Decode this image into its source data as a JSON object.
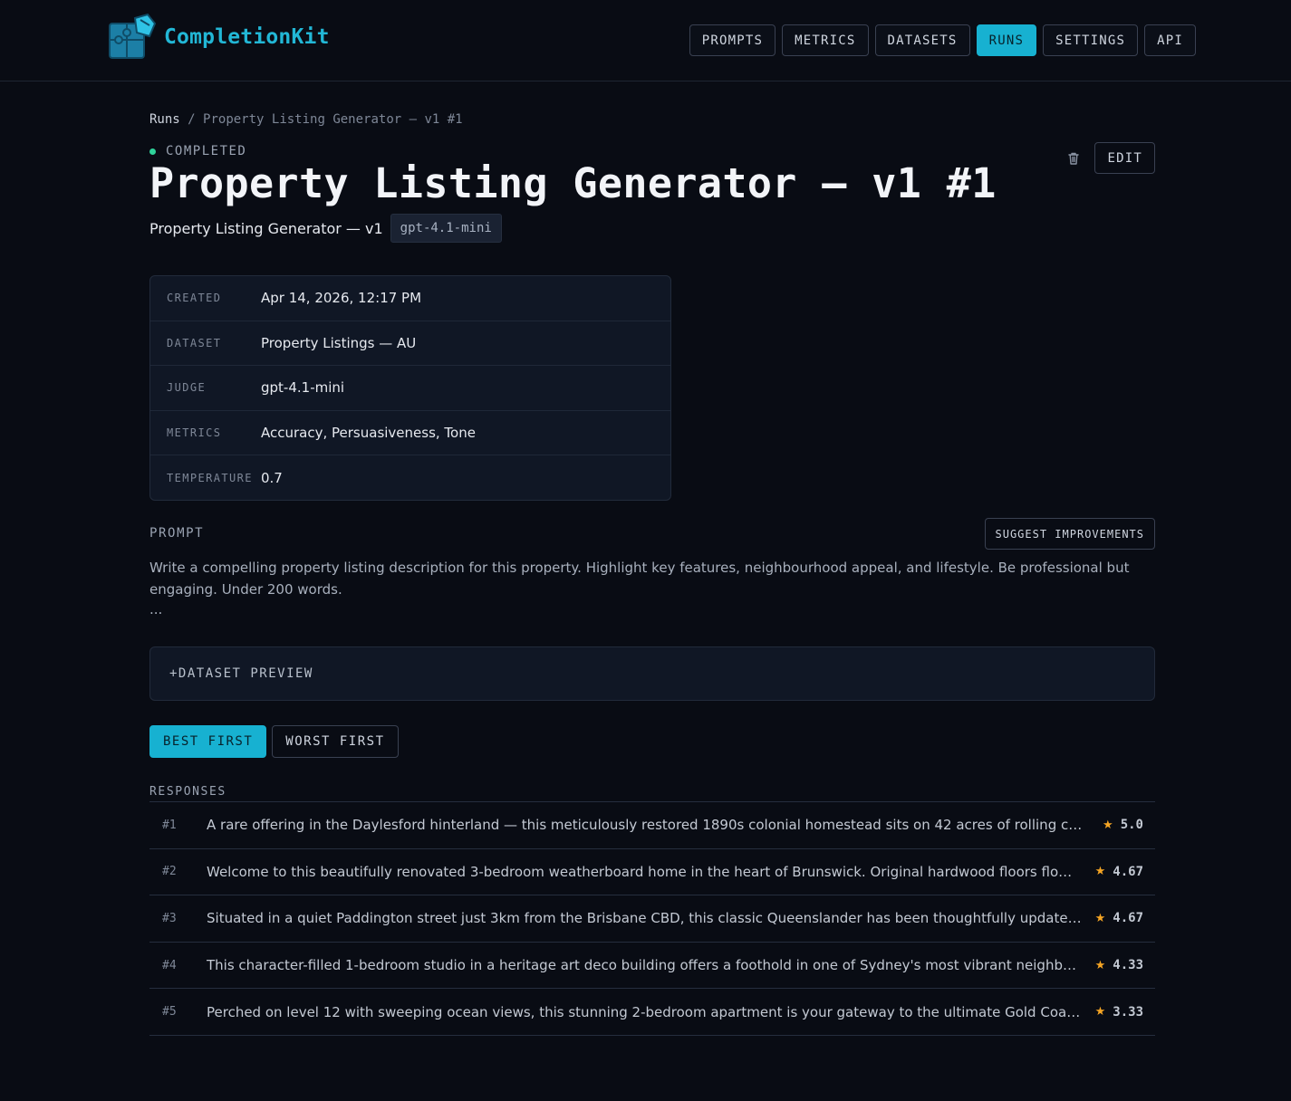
{
  "app": {
    "name": "CompletionKit",
    "logo_icon": "puzzle-icon",
    "accent_color": "#17b1d1"
  },
  "nav": [
    {
      "label": "PROMPTS",
      "active": false
    },
    {
      "label": "METRICS",
      "active": false
    },
    {
      "label": "DATASETS",
      "active": false
    },
    {
      "label": "RUNS",
      "active": true
    },
    {
      "label": "SETTINGS",
      "active": false
    },
    {
      "label": "API",
      "active": false
    }
  ],
  "breadcrumb": {
    "parent": "Runs",
    "separator": "/",
    "current": "Property Listing Generator — v1 #1"
  },
  "run": {
    "status": "COMPLETED",
    "status_color": "#2fd29a",
    "title": "Property Listing Generator — v1 #1",
    "prompt_name": "Property Listing Generator — v1",
    "model": "gpt-4.1-mini",
    "edit_label": "EDIT",
    "delete_icon": "trash-icon"
  },
  "meta": [
    {
      "key": "CREATED",
      "value": "Apr 14, 2026, 12:17 PM"
    },
    {
      "key": "DATASET",
      "value": "Property Listings — AU"
    },
    {
      "key": "JUDGE",
      "value": "gpt-4.1-mini"
    },
    {
      "key": "METRICS",
      "value": "Accuracy, Persuasiveness, Tone"
    },
    {
      "key": "TEMPERATURE",
      "value": "0.7"
    }
  ],
  "prompt": {
    "label": "PROMPT",
    "suggest_label": "SUGGEST IMPROVEMENTS",
    "text": "Write a compelling property listing description for this property. Highlight key features, neighbourhood appeal, and lifestyle. Be professional but engaging. Under 200 words.",
    "ellipsis": "..."
  },
  "dataset_preview": {
    "label": "+DATASET PREVIEW"
  },
  "sort": {
    "best_label": "BEST FIRST",
    "worst_label": "WORST FIRST",
    "active": "best"
  },
  "responses": {
    "label": "RESPONSES",
    "score_icon": "star-icon",
    "score_color": "#f5a524",
    "items": [
      {
        "rank": "#1",
        "text": "A rare offering in the Daylesford hinterland — this meticulously restored 1890s colonial homestead sits on 42 acres of rolling countryside",
        "score": "5.0"
      },
      {
        "rank": "#2",
        "text": "Welcome to this beautifully renovated 3-bedroom weatherboard home in the heart of Brunswick. Original hardwood floors flow throughout",
        "score": "4.67"
      },
      {
        "rank": "#3",
        "text": "Situated in a quiet Paddington street just 3km from the Brisbane CBD, this classic Queenslander has been thoughtfully updated for modern living",
        "score": "4.67"
      },
      {
        "rank": "#4",
        "text": "This character-filled 1-bedroom studio in a heritage art deco building offers a foothold in one of Sydney's most vibrant neighbourhoods",
        "score": "4.33"
      },
      {
        "rank": "#5",
        "text": "Perched on level 12 with sweeping ocean views, this stunning 2-bedroom apartment is your gateway to the ultimate Gold Coast lifestyle",
        "score": "3.33"
      }
    ]
  }
}
